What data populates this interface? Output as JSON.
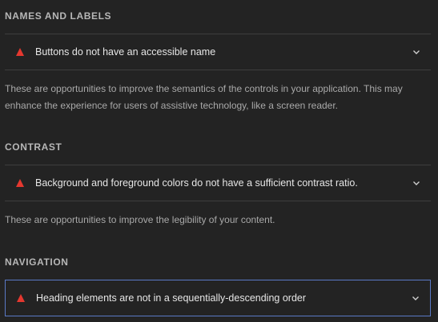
{
  "sections": [
    {
      "title": "NAMES AND LABELS",
      "audit": "Buttons do not have an accessible name",
      "description": "These are opportunities to improve the semantics of the controls in your application. This may enhance the experience for users of assistive technology, like a screen reader."
    },
    {
      "title": "CONTRAST",
      "audit": "Background and foreground colors do not have a sufficient contrast ratio.",
      "description": "These are opportunities to improve the legibility of your content."
    },
    {
      "title": "NAVIGATION",
      "audit": "Heading elements are not in a sequentially-descending order"
    }
  ],
  "icons": {
    "fail": "fail-triangle-icon",
    "expand": "chevron-down-icon"
  },
  "colors": {
    "background": "#232323",
    "fail": "#e5382f",
    "focus_outline": "#5a79c6"
  }
}
